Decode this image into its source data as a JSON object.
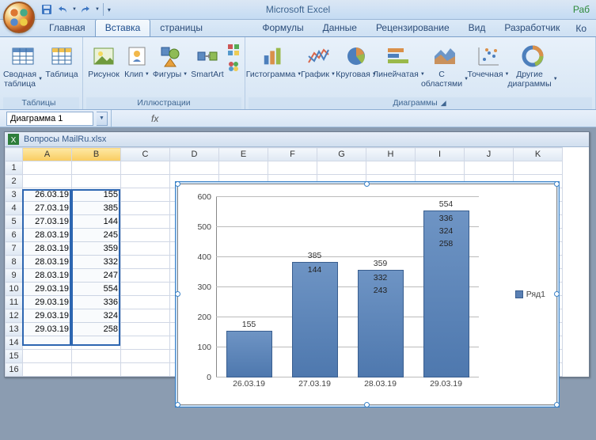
{
  "app_title": "Microsoft Excel",
  "context_tab_hint": "Раб",
  "tabs": [
    "Главная",
    "Вставка",
    "Разметка страницы",
    "Формулы",
    "Данные",
    "Рецензирование",
    "Вид",
    "Разработчик"
  ],
  "tabs_extra": "Ко",
  "active_tab": 1,
  "ribbon": {
    "tables": {
      "label": "Таблицы",
      "pivot": "Сводная таблица",
      "table": "Таблица"
    },
    "illustrations": {
      "label": "Иллюстрации",
      "picture": "Рисунок",
      "clip": "Клип",
      "shapes": "Фигуры",
      "smartart": "SmartArt"
    },
    "charts": {
      "label": "Диаграммы",
      "column": "Гистограмма",
      "line": "График",
      "pie": "Круговая",
      "bar": "Линейчатая",
      "area": "С областями",
      "scatter": "Точечная",
      "other": "Другие диаграммы"
    }
  },
  "namebox_value": "Диаграмма 1",
  "fx_label": "fx",
  "workbook_title": "Вопросы MailRu.xlsx",
  "columns": [
    "A",
    "B",
    "C",
    "D",
    "E",
    "F",
    "G",
    "H",
    "I",
    "J",
    "K"
  ],
  "rows": [
    {
      "n": 1,
      "a": "",
      "b": ""
    },
    {
      "n": 2,
      "a": "",
      "b": ""
    },
    {
      "n": 3,
      "a": "26.03.19",
      "b": "155"
    },
    {
      "n": 4,
      "a": "27.03.19",
      "b": "385"
    },
    {
      "n": 5,
      "a": "27.03.19",
      "b": "144"
    },
    {
      "n": 6,
      "a": "28.03.19",
      "b": "245"
    },
    {
      "n": 7,
      "a": "28.03.19",
      "b": "359"
    },
    {
      "n": 8,
      "a": "28.03.19",
      "b": "332"
    },
    {
      "n": 9,
      "a": "28.03.19",
      "b": "247"
    },
    {
      "n": 10,
      "a": "29.03.19",
      "b": "554"
    },
    {
      "n": 11,
      "a": "29.03.19",
      "b": "336"
    },
    {
      "n": 12,
      "a": "29.03.19",
      "b": "324"
    },
    {
      "n": 13,
      "a": "29.03.19",
      "b": "258"
    },
    {
      "n": 14,
      "a": "",
      "b": ""
    },
    {
      "n": 15,
      "a": "",
      "b": ""
    },
    {
      "n": 16,
      "a": "",
      "b": ""
    }
  ],
  "legend_label": "Ряд1",
  "chart_data": {
    "type": "bar",
    "categories": [
      "26.03.19",
      "27.03.19",
      "28.03.19",
      "29.03.19"
    ],
    "values": [
      155,
      385,
      359,
      554
    ],
    "top_labels": [
      "155",
      "385",
      "359",
      "554"
    ],
    "inner_labels": [
      [
        "144"
      ],
      [
        "332",
        "243"
      ],
      [
        "336",
        "324",
        "258"
      ]
    ],
    "y_ticks": [
      0,
      100,
      200,
      300,
      400,
      500,
      600
    ],
    "ylim": [
      0,
      600
    ],
    "series_name": "Ряд1"
  }
}
